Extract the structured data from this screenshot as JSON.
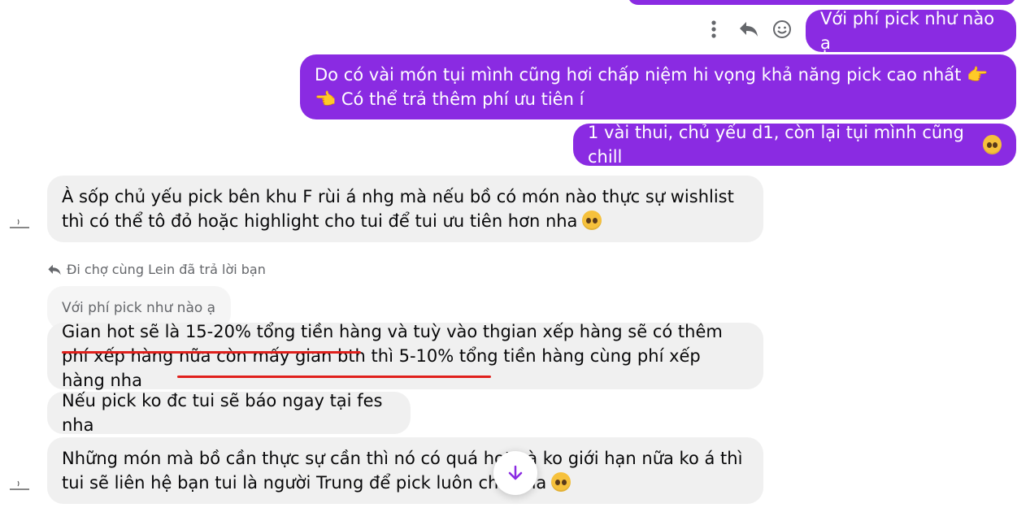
{
  "colors": {
    "accent": "#8a2be2",
    "incoming_bg": "#f0f0f0",
    "underline": "#e0201c"
  },
  "outgoing": [
    {
      "text": "Với phí pick như nào ạ"
    },
    {
      "text": "Do có vài món tụi mình cũng hơi chấp niệm hi vọng khả năng pick cao nhất 👉👈 Có thể trả thêm phí ưu tiên í"
    },
    {
      "text": "1 vài thui, chủ yếu d1, còn lại tụi mình cũng chill"
    }
  ],
  "incoming": [
    {
      "text": "À sốp chủ yếu pick bên khu F rùi á nhg mà nếu bồ có món nào thực sự wishlist thì có thể tô đỏ hoặc highlight cho tui để tui ưu tiên hơn nha"
    },
    {
      "text_part1": "Gian hot sẽ là 15-20% tổng tiền hàng",
      "text_part2": " và tuỳ vào thgian xếp hàng sẽ có thêm phí xếp hàng nữa còn ",
      "text_part3": "mấy gian bth thì 5-10% tổng tiền hàng",
      "text_part4": " cùng phí xếp hàng nha"
    },
    {
      "text": "Nếu pick ko đc tui sẽ báo ngay tại fes nha"
    },
    {
      "text": "Những món mà bồ cần thực sự cần thì nó có quá hot và ko giới hạn nữa ko á thì tui sẽ liên hệ bạn tui là người Trung để pick luôn cho nha"
    }
  ],
  "reply": {
    "hint": "Đi chợ cùng Lein đã trả lời bạn",
    "quoted": "Với phí pick như nào ạ"
  },
  "icons": {
    "more": "more-vertical-icon",
    "reply": "reply-icon",
    "react": "smiley-icon",
    "scroll": "arrow-down-icon"
  }
}
